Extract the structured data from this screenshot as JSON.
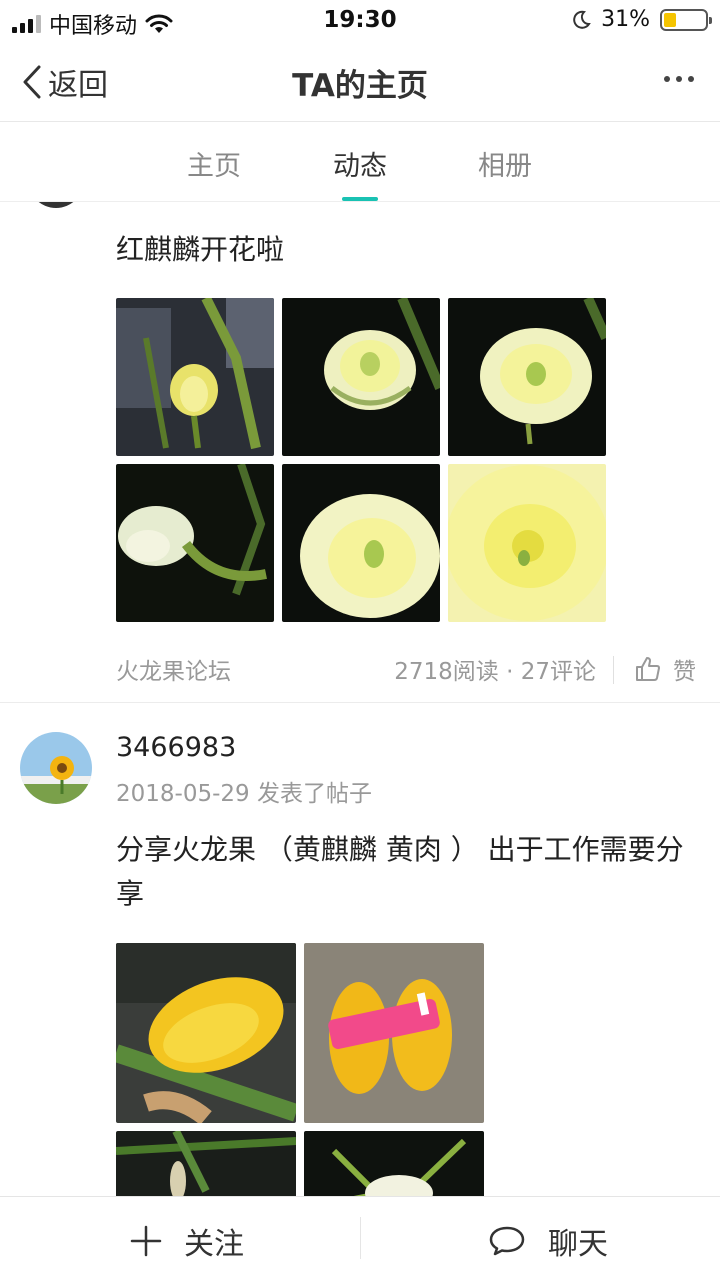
{
  "status_bar": {
    "carrier": "中国移动",
    "time": "19:30",
    "battery": "31%",
    "battery_level": 0.31
  },
  "navbar": {
    "back_label": "返回",
    "title": "TA的主页"
  },
  "tabs": [
    {
      "label": "主页",
      "active": false
    },
    {
      "label": "动态",
      "active": true
    },
    {
      "label": "相册",
      "active": false
    }
  ],
  "posts": [
    {
      "text": "红麒麟开花啦",
      "source": "火龙果论坛",
      "stats": "2718阅读 · 27评论",
      "like_label": "赞"
    },
    {
      "username": "3466983",
      "date": "2018-05-29 发表了帖子",
      "text": "分享火龙果 （黄麒麟 黄肉 ） 出于工作需要分享"
    }
  ],
  "bottom_bar": {
    "follow_label": "关注",
    "chat_label": "聊天"
  },
  "colors": {
    "accent": "#19c2b3",
    "battery": "#f5c400"
  }
}
